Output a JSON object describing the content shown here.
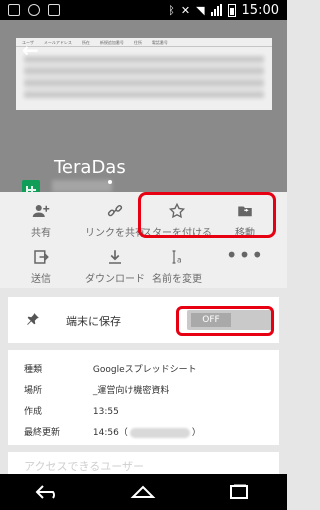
{
  "status_bar": {
    "time": "15:00"
  },
  "preview": {
    "headers": [
      "ユーザ",
      "メールアドレス",
      "所在",
      "新規追加番号",
      "住所",
      "電話番号"
    ],
    "title": "TeraDas"
  },
  "actions": [
    {
      "label": "共有",
      "icon": "person-add-icon"
    },
    {
      "label": "リンクを共有",
      "icon": "link-icon"
    },
    {
      "label": "スターを付ける",
      "icon": "star-icon"
    },
    {
      "label": "移動",
      "icon": "folder-move-icon"
    },
    {
      "label": "送信",
      "icon": "send-icon"
    },
    {
      "label": "ダウンロード",
      "icon": "download-icon"
    },
    {
      "label": "名前を変更",
      "icon": "rename-icon"
    },
    {
      "label": "",
      "icon": "more-icon"
    }
  ],
  "offline": {
    "label": "端末に保存",
    "toggle": "OFF"
  },
  "details": {
    "type_label": "種類",
    "type_value": "Googleスプレッドシート",
    "location_label": "場所",
    "location_value": "_運営向け機密資料",
    "created_label": "作成",
    "created_value": "13:55",
    "modified_label": "最終更新",
    "modified_value": "14:56（",
    "modified_suffix": "）"
  },
  "access_section": {
    "title": "アクセスできるユーザー"
  },
  "colors": {
    "highlight": "#e60012",
    "sheets_green": "#0f9d58"
  }
}
